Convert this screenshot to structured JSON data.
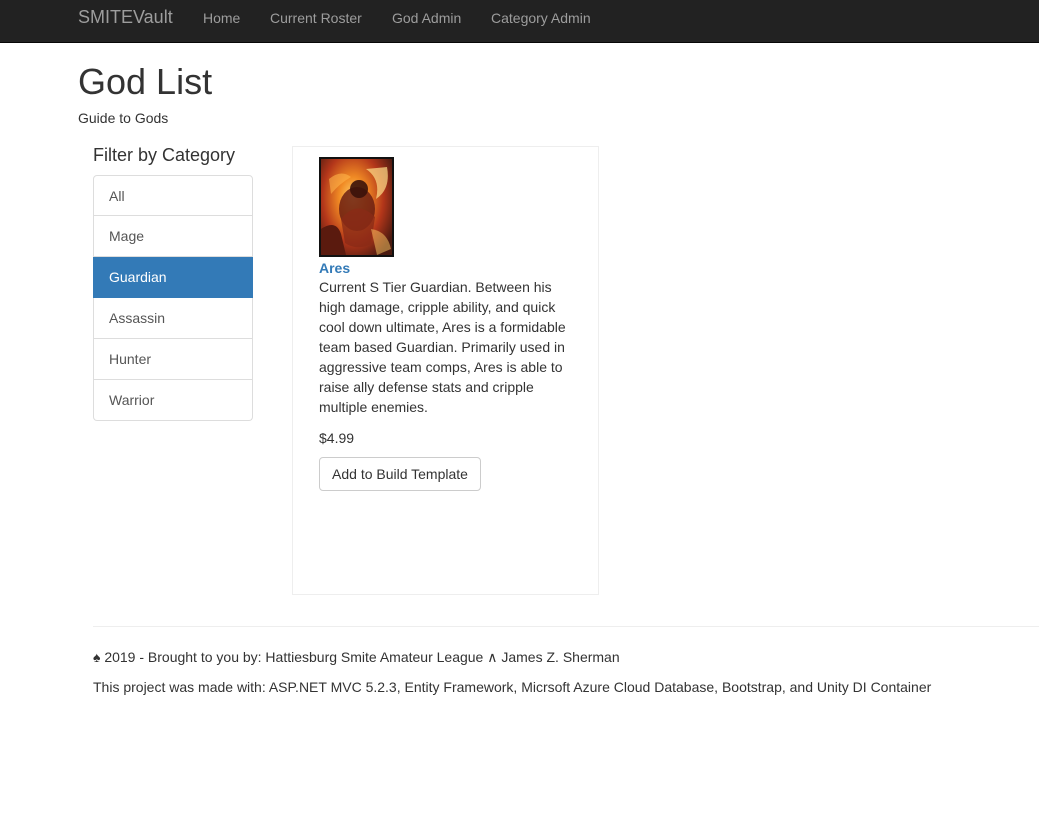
{
  "navbar": {
    "brand": "SMITEVault",
    "links": [
      "Home",
      "Current Roster",
      "God Admin",
      "Category Admin"
    ]
  },
  "header": {
    "title": "God List",
    "subtitle": "Guide to Gods"
  },
  "sidebar": {
    "heading": "Filter by Category",
    "categories": [
      "All",
      "Mage",
      "Guardian",
      "Assassin",
      "Hunter",
      "Warrior"
    ],
    "active": "Guardian"
  },
  "product": {
    "name": "Ares",
    "description": "Current S Tier Guardian. Between his high damage, cripple ability, and quick cool down ultimate, Ares is a formidable team based Guardian. Primarily used in aggressive team comps, Ares is able to raise ally defense stats and cripple multiple enemies.",
    "price": "$4.99",
    "button_label": "Add to Build Template"
  },
  "footer": {
    "credit": "♠ 2019 - Brought to you by: Hattiesburg Smite Amateur League ∧ James Z. Sherman",
    "tech": "This project was made with: ASP.NET MVC 5.2.3, Entity Framework, Micrsoft Azure Cloud Database, Bootstrap, and Unity DI Container"
  },
  "colors": {
    "navbar_bg": "#222222",
    "nav_text": "#9d9d9d",
    "accent": "#337ab7"
  }
}
